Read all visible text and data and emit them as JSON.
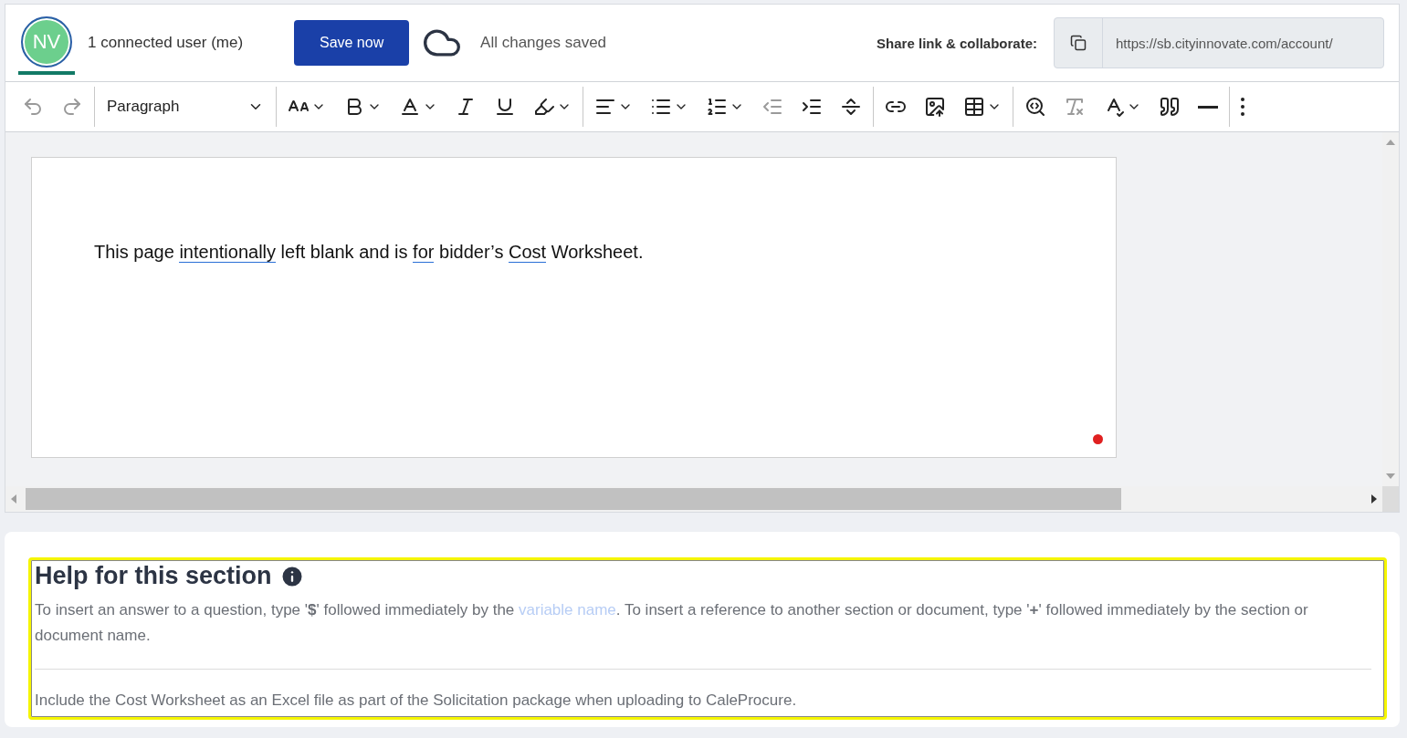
{
  "header": {
    "avatar": "NV",
    "connected": "1 connected user (me)",
    "save_button": "Save now",
    "status": "All changes saved",
    "share_label": "Share link & collaborate:",
    "share_url": "https://sb.cityinnovate.com/account/"
  },
  "toolbar": {
    "groups": [
      [
        {
          "dropdown": false,
          "disabled": true
        },
        {
          "dropdown": false,
          "disabled": true
        }
      ],
      [
        {
          "kind": "select",
          "value": "Paragraph"
        }
      ],
      [
        {
          "dropdown": true,
          "disabled": false
        },
        {
          "dropdown": true,
          "disabled": false
        },
        {
          "dropdown": true,
          "disabled": false
        },
        {
          "dropdown": false,
          "disabled": false
        },
        {
          "dropdown": false,
          "disabled": false
        },
        {
          "dropdown": true,
          "disabled": false
        }
      ],
      [
        {
          "dropdown": true,
          "disabled": false
        },
        {
          "dropdown": true,
          "disabled": false
        },
        {
          "dropdown": true,
          "disabled": false
        },
        {
          "dropdown": false,
          "disabled": true
        },
        {
          "dropdown": false,
          "disabled": false
        },
        {
          "dropdown": false,
          "disabled": false
        }
      ],
      [
        {
          "dropdown": false,
          "disabled": false
        },
        {
          "dropdown": false,
          "disabled": false
        },
        {
          "dropdown": true,
          "disabled": false
        }
      ],
      [
        {
          "dropdown": false,
          "disabled": false
        },
        {
          "dropdown": false,
          "disabled": true
        },
        {
          "dropdown": true,
          "disabled": false
        },
        {
          "dropdown": false,
          "disabled": false
        },
        {
          "dropdown": false,
          "disabled": false
        }
      ],
      [
        {
          "dropdown": false,
          "disabled": false
        }
      ]
    ]
  },
  "document": {
    "segments": [
      {
        "text": "This page ",
        "underlined": false
      },
      {
        "text": "intentionally",
        "underlined": true
      },
      {
        "text": " left blank and is ",
        "underlined": false
      },
      {
        "text": "for",
        "underlined": true
      },
      {
        "text": " bidder’s ",
        "underlined": false
      },
      {
        "text": "Cost",
        "underlined": true
      },
      {
        "text": " Worksheet.",
        "underlined": false
      }
    ]
  },
  "help": {
    "title": "Help for this section",
    "before": "To insert an answer to a question, type '**$**' followed immediately by the ",
    "link": "variable name",
    "after": ". To insert a reference to another section or document, type '**+**' followed immediately by the section or document name.",
    "note": "Include the Cost Worksheet as an Excel file as part of the Solicitation package when uploading to CaleProcure."
  }
}
